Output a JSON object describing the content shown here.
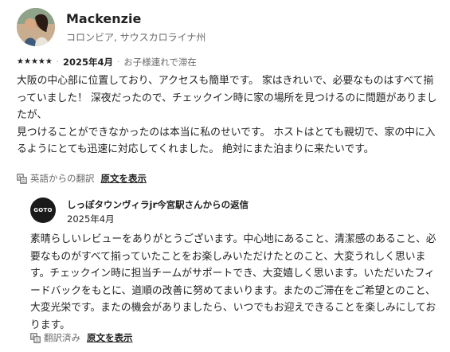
{
  "review": {
    "author_name": "Mackenzie",
    "author_location": "コロンビア, サウスカロライナ州",
    "rating": 5,
    "date": "2025年4月",
    "trip_type": "お子様連れで滞在",
    "text_lines": [
      "大阪の中心部に位置しており、アクセスも簡単です。 家はきれいで、必要なものはすべて揃っていました！ 深夜だったので、チェックイン時に家の場所を見つけるのに問題がありましたが、",
      "見つけることができなかったのは本当に私のせいです。 ホストはとても親切で、家の中に入るようにとても迅速に対応してくれました。 絶対にまた泊まりに来たいです。"
    ],
    "translation_label": "英語からの翻訳",
    "show_original_label": "原文を表示"
  },
  "host_reply": {
    "logo_text": "GOTO",
    "title": "しっぽタウンヴィラjr今宮駅さんからの返信",
    "date": "2025年4月",
    "text": "素晴らしいレビューをありがとうございます。中心地にあること、清潔感のあること、必要なものがすべて揃っていたことをお楽しみいただけたとのこと、大変うれしく思います。チェックイン時に担当チームがサポートでき、大変嬉しく思います。いただいたフィードバックをもとに、道順の改善に努めてまいります。またのご滞在をご希望とのこと、大変光栄です。またの機会がありましたら、いつでもお迎えできることを楽しみにしております。",
    "translation_label": "翻訳済み",
    "show_original_label": "原文を表示"
  }
}
